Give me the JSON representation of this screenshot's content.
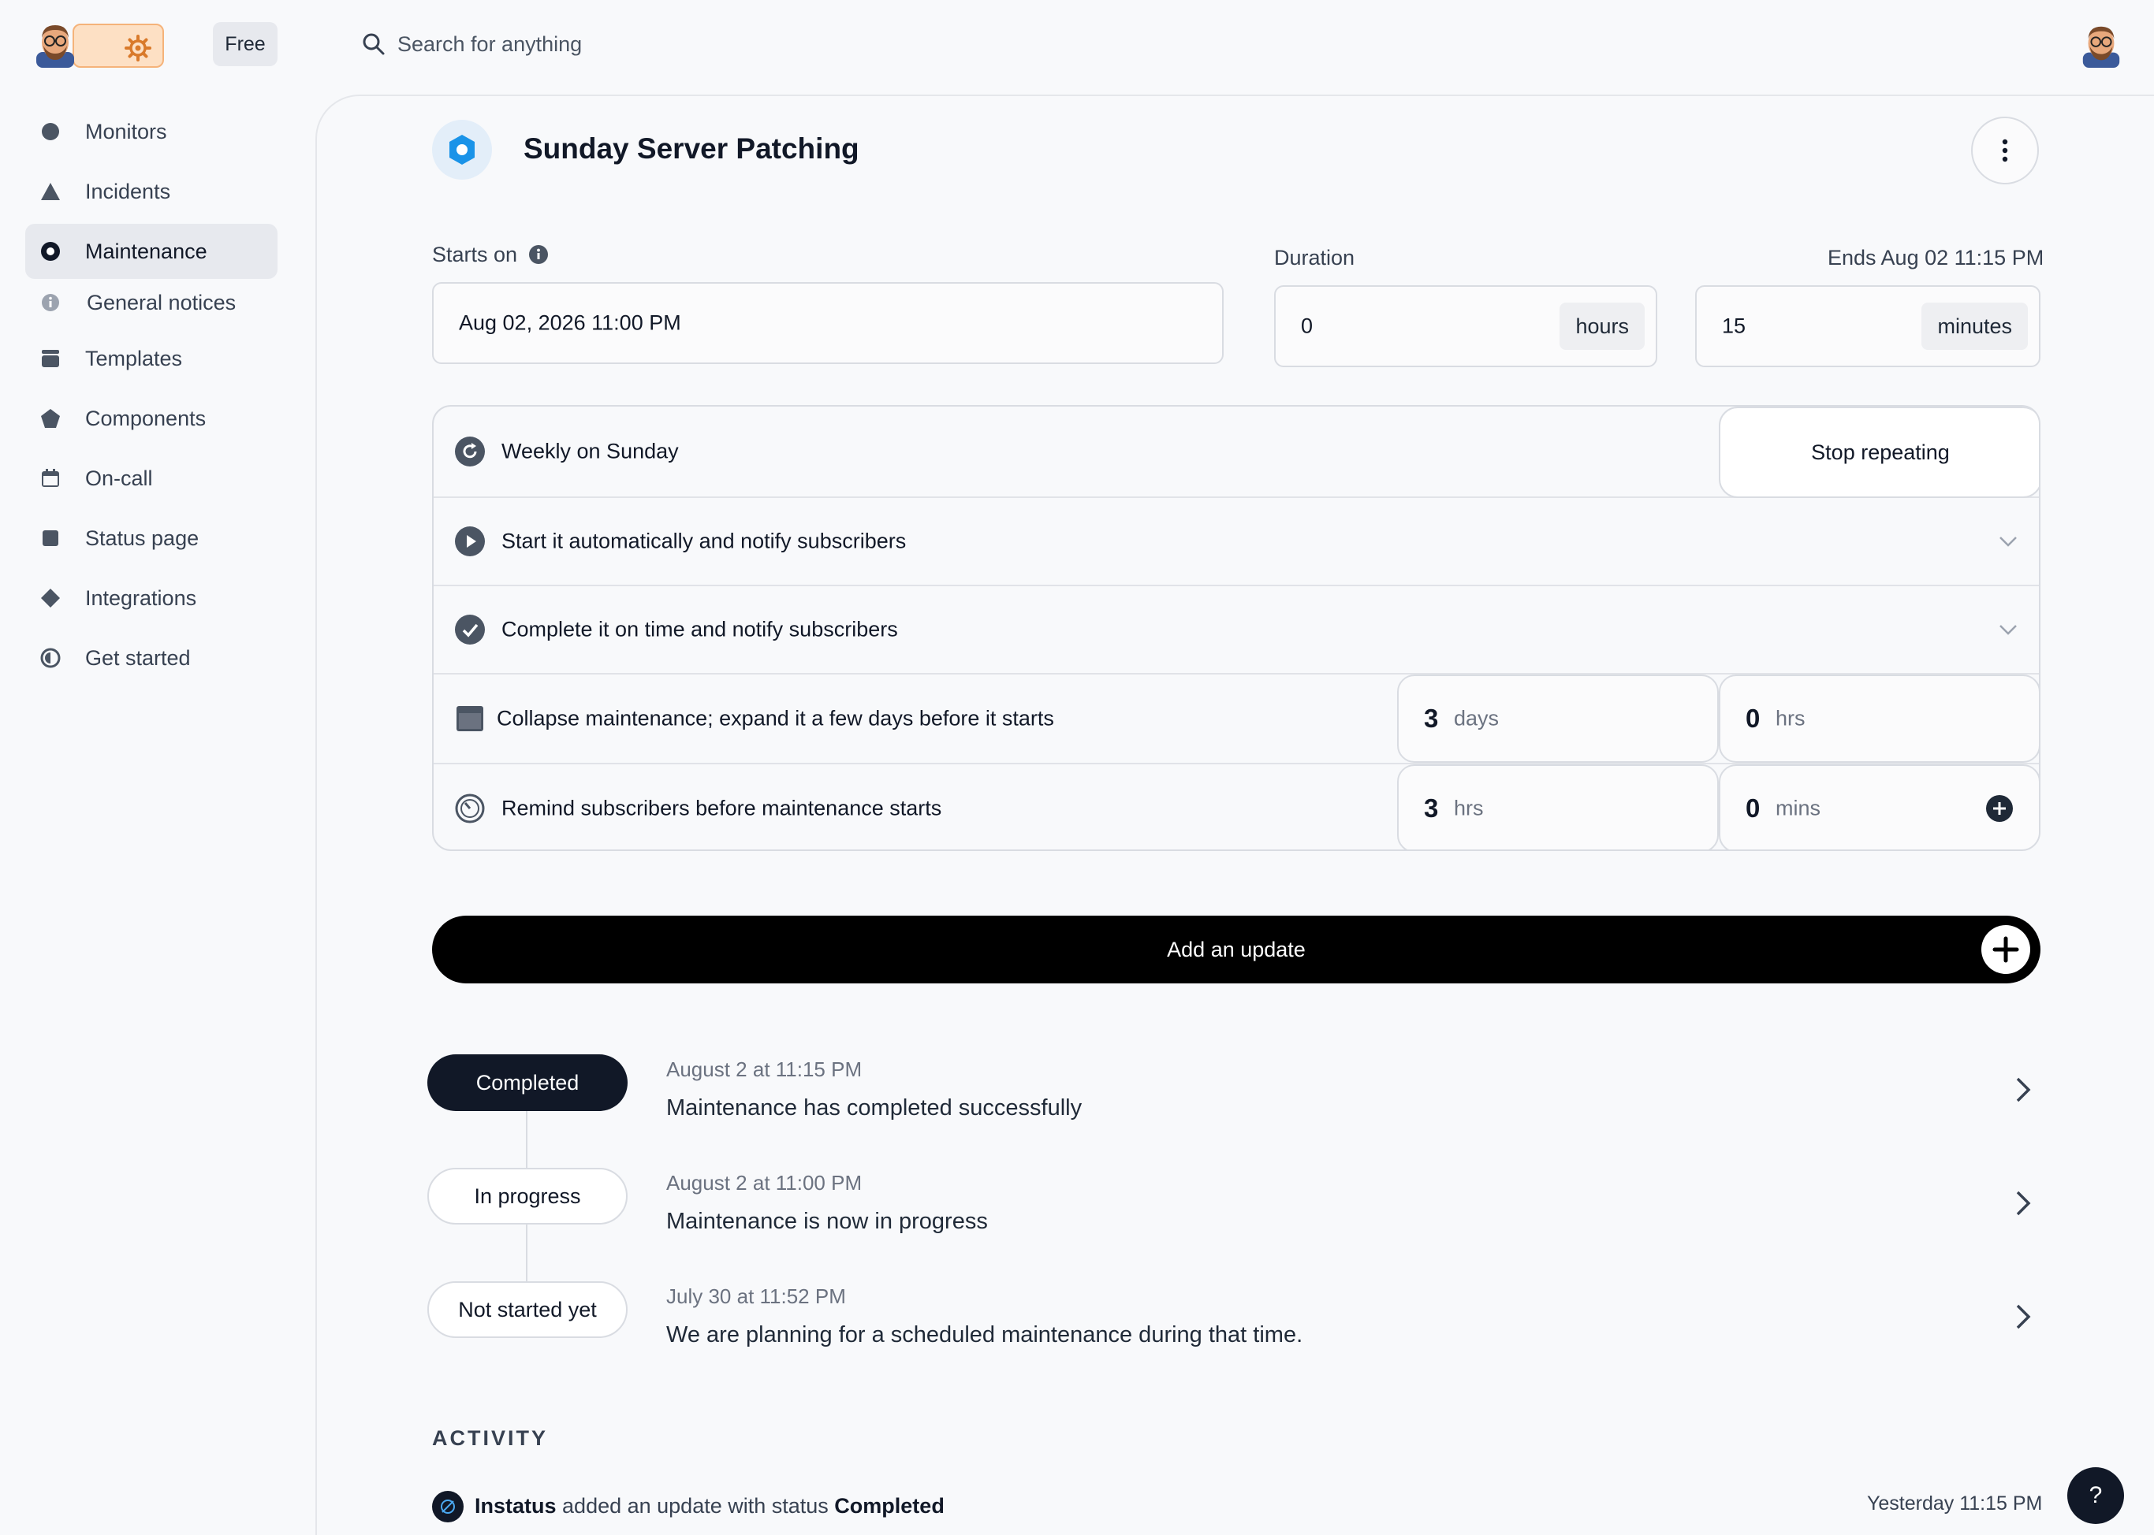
{
  "topbar": {
    "plan": "Free",
    "search_placeholder": "Search for anything"
  },
  "sidebar": {
    "items": [
      {
        "label": "Monitors",
        "icon": "circle-icon"
      },
      {
        "label": "Incidents",
        "icon": "triangle-icon"
      },
      {
        "label": "Maintenance",
        "icon": "hexagon-ring-icon",
        "active": true
      },
      {
        "label": "General notices",
        "icon": "info-icon",
        "sub": true
      },
      {
        "label": "Templates",
        "icon": "stack-icon"
      },
      {
        "label": "Components",
        "icon": "pentagon-icon"
      },
      {
        "label": "On-call",
        "icon": "calendar-icon"
      },
      {
        "label": "Status page",
        "icon": "square-icon"
      },
      {
        "label": "Integrations",
        "icon": "diamond-icon"
      },
      {
        "label": "Get started",
        "icon": "half-circle-icon"
      }
    ]
  },
  "maintenance": {
    "title": "Sunday Server Patching",
    "starts_on_label": "Starts on",
    "starts_on_value": "Aug 02, 2026 11:00 PM",
    "duration_label": "Duration",
    "ends_label": "Ends Aug 02 11:15 PM",
    "duration_hours": "0",
    "hours_unit": "hours",
    "duration_minutes": "15",
    "minutes_unit": "minutes"
  },
  "options": {
    "repeat_label": "Weekly on Sunday",
    "stop_repeating": "Stop repeating",
    "auto_start": "Start it automatically and notify subscribers",
    "auto_complete": "Complete it on time and notify subscribers",
    "collapse_label": "Collapse maintenance; expand it a few days before it starts",
    "collapse_days": "3",
    "collapse_days_unit": "days",
    "collapse_hrs": "0",
    "collapse_hrs_unit": "hrs",
    "remind_label": "Remind subscribers before maintenance starts",
    "remind_hrs": "3",
    "remind_hrs_unit": "hrs",
    "remind_mins": "0",
    "remind_mins_unit": "mins"
  },
  "add_update": "Add an update",
  "updates": [
    {
      "status": "Completed",
      "date": "August 2 at 11:15 PM",
      "message": "Maintenance has completed successfully"
    },
    {
      "status": "In progress",
      "date": "August 2 at 11:00 PM",
      "message": "Maintenance is now in progress"
    },
    {
      "status": "Not started yet",
      "date": "July 30 at 11:52 PM",
      "message": "We are planning for a scheduled maintenance during that time."
    }
  ],
  "activity": {
    "title": "ACTIVITY",
    "actor": "Instatus",
    "action": " added an update with status ",
    "status": "Completed",
    "time": "Yesterday 11:15 PM"
  },
  "help_label": "?",
  "colors": {
    "accent_blue": "#1a93e8",
    "dark": "#111827",
    "logo_orange": "#f5a35c"
  }
}
